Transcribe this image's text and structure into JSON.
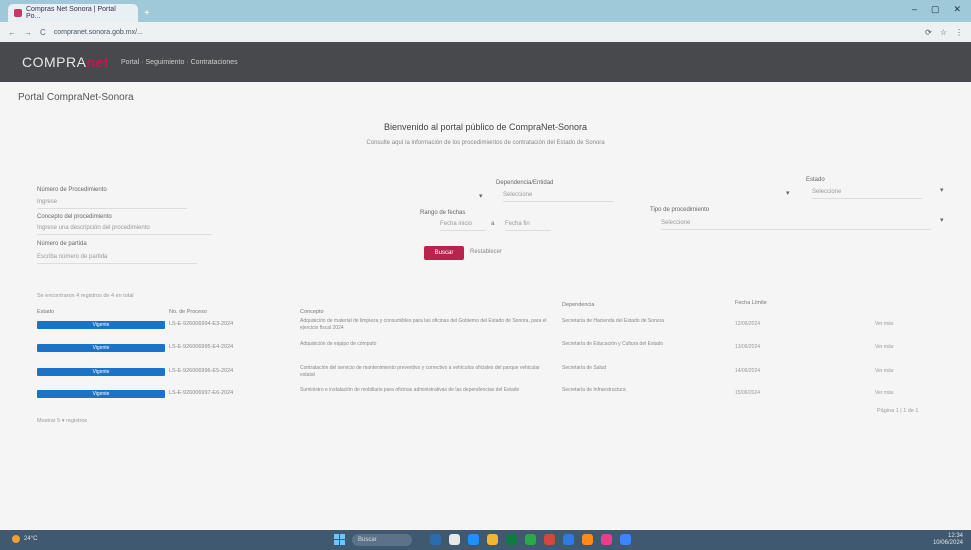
{
  "browser": {
    "tab_title": "Compras Net Sonora | Portal Po...",
    "new_tab": "+",
    "url": "compranet.sonora.gob.mx/...",
    "window_controls": [
      "–",
      "▢",
      "✕"
    ],
    "toolbar_icons": [
      "⟳",
      "☆",
      "⋮"
    ]
  },
  "app": {
    "logo_main": "COMPRA",
    "logo_accent": "net",
    "nav": "Portal · Seguimiento · Contrataciones"
  },
  "portal_title": "Portal CompraNet-Sonora",
  "hero": {
    "title": "Bienvenido al portal público de CompraNet-Sonora",
    "subtitle": "Consulte aquí la información de los procedimientos de contratación del Estado de Sonora"
  },
  "filters": {
    "numero_label": "Número de Procedimiento",
    "numero_value": "Ingrese",
    "dependencia_label": "Dependencia/Entidad",
    "dependencia_value": "Seleccione",
    "estado_label": "Estado",
    "estado_value": "Seleccione",
    "concepto_label": "Concepto del procedimiento",
    "concepto_value": "Ingrese una descripción del procedimiento",
    "fechas_label": "Rango de fechas",
    "fecha_inicio": "Fecha inicio",
    "fecha_sep": "a",
    "fecha_fin": "Fecha fin",
    "tipo_label": "Tipo de procedimiento",
    "tipo_value": "Seleccione",
    "partida_label": "Número de partida",
    "partida_value": "Escriba número de partida"
  },
  "actions": {
    "search": "Buscar",
    "clear": "Restablecer"
  },
  "results": {
    "count_text": "Se encontraron 4 registros de 4 en total",
    "headers": [
      "Estado",
      "No. de Proceso",
      "Concepto",
      "Dependencia",
      "Fecha Límite",
      ""
    ],
    "rows": [
      {
        "status": "Vigente",
        "number": "LS-E-926006994-E3-2024",
        "concept": "Adquisición de material de limpieza y consumibles para las oficinas del Gobierno del Estado de Sonora, para el ejercicio fiscal 2024",
        "agency": "Secretaría de Hacienda del Estado de Sonora",
        "date": "12/06/2024",
        "link": "Ver más"
      },
      {
        "status": "Vigente",
        "number": "LS-E-926006995-E4-2024",
        "concept": "Adquisición de equipo de cómputo",
        "agency": "Secretaría de Educación y Cultura del Estado",
        "date": "13/06/2024",
        "link": "Ver más"
      },
      {
        "status": "Vigente",
        "number": "LS-E-926006996-E5-2024",
        "concept": "Contratación del servicio de mantenimiento preventivo y correctivo a vehículos oficiales del parque vehicular estatal",
        "agency": "Secretaría de Salud",
        "date": "14/06/2024",
        "link": "Ver más"
      },
      {
        "status": "Vigente",
        "number": "LS-E-926006997-E6-2024",
        "concept": "Suministro e instalación de mobiliario para oficinas administrativas de las dependencias del Estado",
        "agency": "Secretaría de Infraestructura",
        "date": "15/06/2024",
        "link": "Ver más"
      }
    ]
  },
  "pager": {
    "per_page_label": "Mostrar",
    "per_page_value": "5",
    "per_page_suffix": "registros",
    "page_text": "Página 1  |  1  de  1"
  },
  "taskbar": {
    "weather": "24°C",
    "search": "Buscar",
    "time": "12:34",
    "date": "10/06/2024"
  },
  "colors": {
    "accent": "#b8244e",
    "status_blue": "#1a73c6",
    "header_bg": "#47494c",
    "taskbar_bg": "#3f5a70"
  }
}
